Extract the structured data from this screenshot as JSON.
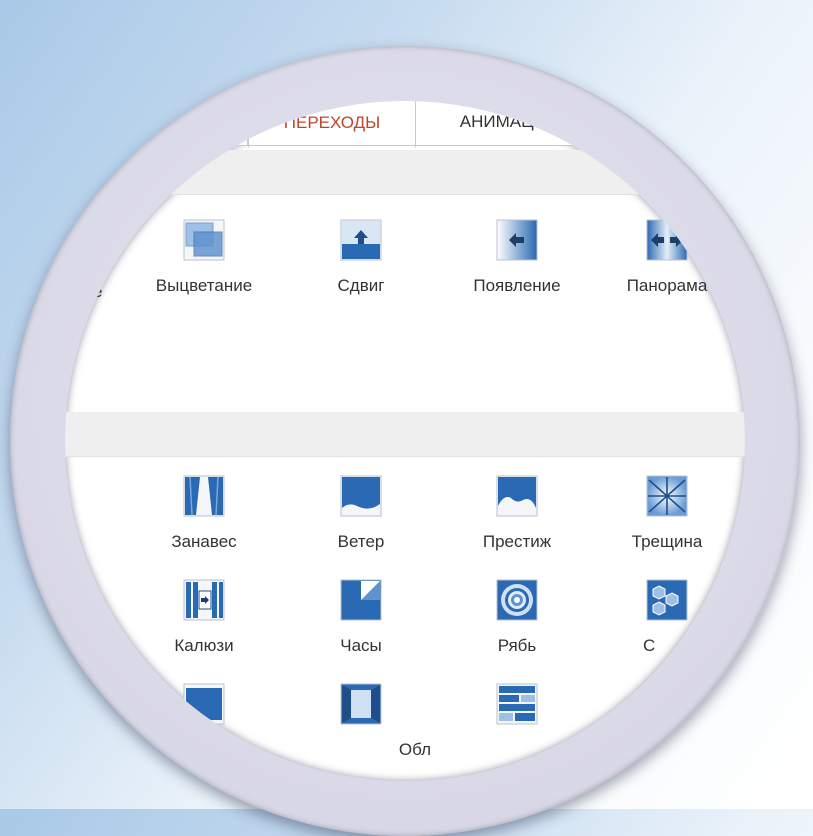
{
  "tabs": {
    "active": "ПЕРЕХОДЫ",
    "next": "АНИМАЦИЯ"
  },
  "colors": {
    "active_tab_text": "#c0442a",
    "icon_blue": "#2a69b3",
    "icon_light": "#cfe0f3"
  },
  "gallery_top": {
    "partial_label": "е",
    "items": [
      {
        "label": "Выцветание",
        "icon": "fade-icon"
      },
      {
        "label": "Сдвиг",
        "icon": "push-icon"
      },
      {
        "label": "Появление",
        "icon": "wipe-icon"
      },
      {
        "label": "Панорама",
        "icon": "split-icon"
      }
    ]
  },
  "gallery_bottom": {
    "row1": [
      {
        "label": "Занавес",
        "icon": "curtains-icon"
      },
      {
        "label": "Ветер",
        "icon": "wind-icon"
      },
      {
        "label": "Престиж",
        "icon": "prestige-icon"
      },
      {
        "label": "Трещина",
        "icon": "shatter-icon"
      }
    ],
    "row2": [
      {
        "label": "Калюзи",
        "icon": "blinds-icon"
      },
      {
        "label": "Часы",
        "icon": "clock-icon"
      },
      {
        "label": "Рябь",
        "icon": "ripple-icon"
      },
      {
        "label": "С",
        "icon": "honeycomb-icon"
      }
    ],
    "row3": [
      {
        "label": "",
        "icon": "cube-icon"
      },
      {
        "label": "Обл",
        "icon": "doors-icon"
      },
      {
        "label": "",
        "icon": "box-icon"
      }
    ]
  }
}
